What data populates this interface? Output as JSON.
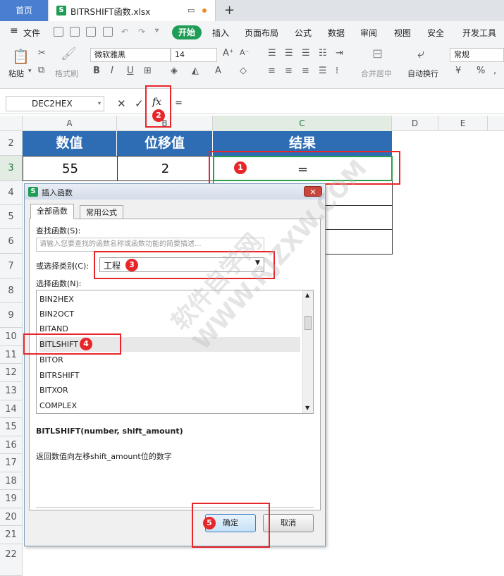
{
  "tabs": {
    "home": "首页",
    "file": "BITRSHIFT函数.xlsx",
    "new_tab": "+"
  },
  "menu": {
    "file": "文件",
    "start": "开始",
    "items": [
      "插入",
      "页面布局",
      "公式",
      "数据",
      "审阅",
      "视图",
      "安全",
      "开发工具"
    ]
  },
  "ribbon": {
    "paste": "粘贴",
    "format_painter": "格式刷",
    "font_name": "微软雅黑",
    "font_size": "14",
    "merge_center": "合并居中",
    "wrap_text": "自动换行",
    "number_format": "常规"
  },
  "formula_bar": {
    "name_box": "DEC2HEX",
    "cancel": "✕",
    "confirm": "✓",
    "fx": "fx",
    "content": "="
  },
  "sheet": {
    "columns": [
      "A",
      "B",
      "C",
      "D",
      "E"
    ],
    "rows": [
      "2",
      "3",
      "4",
      "5",
      "6",
      "7",
      "8",
      "9",
      "10",
      "11",
      "12",
      "13",
      "14",
      "15",
      "16",
      "17",
      "18",
      "19",
      "20",
      "21",
      "22"
    ],
    "headers": [
      "数值",
      "位移值",
      "结果"
    ],
    "row3": [
      "55",
      "2",
      "="
    ]
  },
  "dialog": {
    "title": "插入函数",
    "tab_all": "全部函数",
    "tab_common": "常用公式",
    "search_label": "查找函数(S):",
    "search_placeholder": "请输入您要查找的函数名称或函数功能的简要描述...",
    "category_label": "或选择类别(C):",
    "category_value": "工程",
    "function_label": "选择函数(N):",
    "functions": [
      "BIN2HEX",
      "BIN2OCT",
      "BITAND",
      "BITLSHIFT",
      "BITOR",
      "BITRSHIFT",
      "BITXOR",
      "COMPLEX"
    ],
    "selected_function": "BITLSHIFT",
    "signature": "BITLSHIFT(number, shift_amount)",
    "description": "返回数值向左移shift_amount位的数字",
    "ok": "确定",
    "cancel": "取消"
  },
  "annotations": [
    "1",
    "2",
    "3",
    "4",
    "5"
  ],
  "watermark": "软件自学网 WWW.RJZXW.COM",
  "colors": {
    "header_blue": "#2e6db4",
    "wps_green": "#1f9d57",
    "annotation_red": "#e8262a",
    "selection_green": "#2b9f4a"
  }
}
